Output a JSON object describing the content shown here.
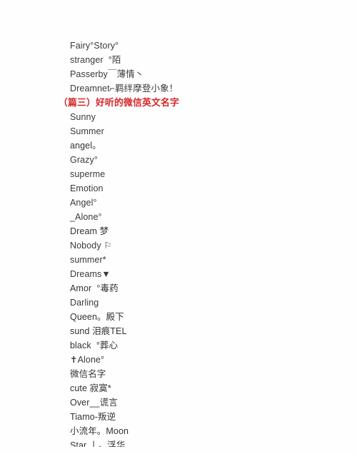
{
  "document": {
    "background_color": "#fdfefd",
    "body_text_color": "#3a3a3a",
    "heading_color": "#d6262a",
    "heading": "（篇三）好听的微信英文名字",
    "lines_before_heading": [
      "Fairy°Story°",
      "stranger  °陌",
      "Passerby￣薄情丶",
      "Dreamnet⌐羁绊摩登小象！"
    ],
    "lines_after_heading": [
      "Sunny",
      "Summer",
      "angel。",
      "Grazy°",
      "superme",
      "Emotion",
      "Angel°",
      "_Alone°",
      "Dream 梦",
      "Nobody ⚐",
      "summer*",
      "Dreams▼",
      "Amor  °毒药",
      "Darling",
      "Queen。殿下",
      "sund 泪痕TEL",
      "black  °葬心",
      "✝Alone°",
      "微信名字",
      "cute 寂寞*",
      "Over__谎言",
      "Tiamo-叛逆",
      "小流年。Moon",
      "Star 丨。浮华"
    ]
  }
}
